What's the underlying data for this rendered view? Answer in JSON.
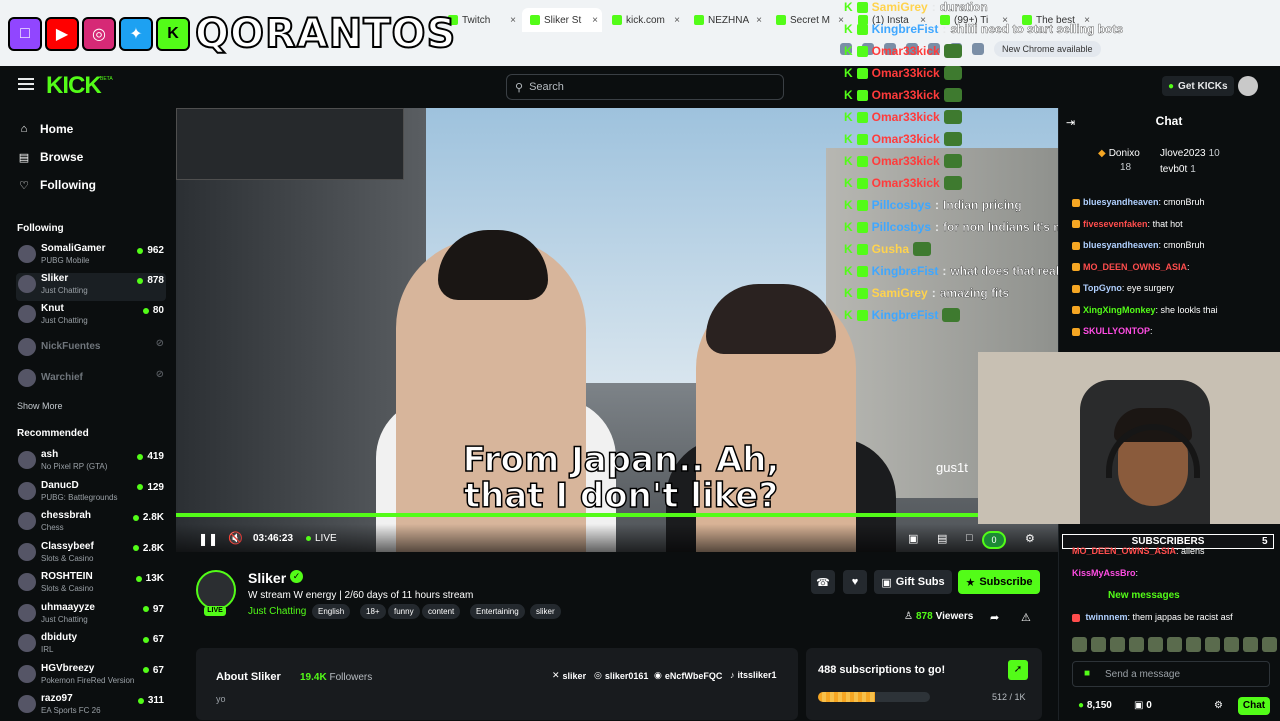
{
  "browser": {
    "tabs": [
      {
        "label": "Twitch"
      },
      {
        "label": "Sliker St"
      },
      {
        "label": "kick.com"
      },
      {
        "label": "NEZHNA"
      },
      {
        "label": "Secret M"
      },
      {
        "label": "(1) Insta"
      },
      {
        "label": "(99+) Ti"
      },
      {
        "label": "The best"
      }
    ],
    "new_chrome_label": "New Chrome available"
  },
  "overlay": {
    "brand_text": "QORANTOS",
    "chat": [
      {
        "user": "SamiGrey",
        "message": "duration",
        "user_color": "#ffd34d"
      },
      {
        "user": "KingbreFist",
        "message": "shiiii need to start selling bots",
        "user_color": "#3fa7ff"
      },
      {
        "user": "Omar33kick",
        "message": "",
        "user_color": "#ff3b3b"
      },
      {
        "user": "Omar33kick",
        "message": "",
        "user_color": "#ff3b3b"
      },
      {
        "user": "Omar33kick",
        "message": "",
        "user_color": "#ff3b3b"
      },
      {
        "user": "Omar33kick",
        "message": "",
        "user_color": "#ff3b3b"
      },
      {
        "user": "Omar33kick",
        "message": "",
        "user_color": "#ff3b3b"
      },
      {
        "user": "Omar33kick",
        "message": "",
        "user_color": "#ff3b3b"
      },
      {
        "user": "Omar33kick",
        "message": "",
        "user_color": "#ff3b3b"
      },
      {
        "user": "Pillcosbys",
        "message": "Indian pricing",
        "user_color": "#3fa7ff"
      },
      {
        "user": "Pillcosbys",
        "message": "for non Indians it's more expensive",
        "user_color": "#3fa7ff"
      },
      {
        "user": "Gusha",
        "message": "",
        "user_color": "#ffd34d"
      },
      {
        "user": "KingbreFist",
        "message": "what does that really get u in the long though",
        "user_color": "#3fa7ff"
      },
      {
        "user": "SamiGrey",
        "message": "amazing fits",
        "user_color": "#ffd34d"
      },
      {
        "user": "KingbreFist",
        "message": "",
        "user_color": "#3fa7ff"
      }
    ]
  },
  "header": {
    "logo": "KICK",
    "logo_badge": "BETA",
    "search_placeholder": "Search",
    "get_kicks_label": "Get KICKs"
  },
  "sidebar": {
    "nav": [
      {
        "label": "Home",
        "icon": "home-icon"
      },
      {
        "label": "Browse",
        "icon": "browse-icon"
      },
      {
        "label": "Following",
        "icon": "heart-icon"
      }
    ],
    "following_heading": "Following",
    "following": [
      {
        "name": "SomaliGamer",
        "category": "PUBG Mobile",
        "viewers": "962",
        "live": true
      },
      {
        "name": "Sliker",
        "category": "Just Chatting",
        "viewers": "878",
        "live": true
      },
      {
        "name": "Knut",
        "category": "Just Chatting",
        "viewers": "80",
        "live": true
      },
      {
        "name": "NickFuentes",
        "category": "",
        "viewers": "",
        "live": false
      },
      {
        "name": "Warchief",
        "category": "",
        "viewers": "",
        "live": false
      }
    ],
    "show_more": "Show More",
    "recommended_heading": "Recommended",
    "recommended": [
      {
        "name": "ash",
        "category": "No Pixel RP (GTA)",
        "viewers": "419"
      },
      {
        "name": "DanucD",
        "category": "PUBG: Battlegrounds",
        "viewers": "129"
      },
      {
        "name": "chessbrah",
        "category": "Chess",
        "viewers": "2.8K"
      },
      {
        "name": "Classybeef",
        "category": "Slots & Casino",
        "viewers": "2.8K"
      },
      {
        "name": "ROSHTEIN",
        "category": "Slots & Casino",
        "viewers": "13K"
      },
      {
        "name": "uhmaayyze",
        "category": "Just Chatting",
        "viewers": "97"
      },
      {
        "name": "dbiduty",
        "category": "IRL",
        "viewers": "67"
      },
      {
        "name": "HGVbreezy",
        "category": "Pokemon FireRed Version",
        "viewers": "67"
      },
      {
        "name": "razo97",
        "category": "EA Sports FC 26",
        "viewers": "311"
      }
    ]
  },
  "player": {
    "subtitle_line1": "From Japan.. Ah,",
    "subtitle_line2": "that I don't like?",
    "watermark": "gus1t",
    "time": "03:46:23",
    "live_label": "LIVE",
    "progress": 1.0
  },
  "channel": {
    "name": "Sliker",
    "live_badge": "LIVE",
    "title": "W stream W energy | 2/60 days of 11 hours stream",
    "category": "Just Chatting",
    "tags": [
      "English",
      "18+",
      "funny",
      "content",
      "Entertaining",
      "sliker"
    ],
    "gift_subs_label": "Gift Subs",
    "subscribe_label": "Subscribe",
    "viewers": "878",
    "viewers_label": "Viewers",
    "about_title": "About Sliker",
    "followers": "19.4K",
    "followers_label": "Followers",
    "bio": "yo",
    "socials": [
      {
        "label": "sliker",
        "icon": "x-icon"
      },
      {
        "label": "sliker0161",
        "icon": "instagram-icon"
      },
      {
        "label": "eNcfWbeFQC",
        "icon": "discord-icon"
      },
      {
        "label": "itssliker1",
        "icon": "tiktok-icon"
      }
    ],
    "sub_goal_text": "488 subscriptions to go!",
    "sub_goal_count": "512 / 1K",
    "sub_goal_progress": 0.512
  },
  "chat": {
    "title": "Chat",
    "gifters": [
      {
        "name": "Donixo",
        "count": "18"
      },
      {
        "name": "Jlove2023",
        "count": "10"
      },
      {
        "name": "tevb0t",
        "count": "1"
      }
    ],
    "messages": [
      {
        "user": "bluesyandheaven",
        "text": "cmonBruh",
        "color": "#b0d0ff"
      },
      {
        "user": "fivesevenfaken",
        "text": "that hot",
        "color": "#ff4d4d"
      },
      {
        "user": "bluesyandheaven",
        "text": "cmonBruh",
        "color": "#b0d0ff"
      },
      {
        "user": "MO_DEEN_OWNS_ASIA",
        "text": "",
        "color": "#ff4d4d"
      },
      {
        "user": "TopGyno",
        "text": "eye surgery",
        "color": "#b0d0ff"
      },
      {
        "user": "XingXingMonkey",
        "text": "she lookls thai",
        "color": "#53fc18"
      },
      {
        "user": "SKULLYONTOP",
        "text": "",
        "color": "#ff4de3"
      }
    ],
    "subscribers_label": "SUBSCRIBERS",
    "subscribers_count": "5",
    "subscribers_goal_badge": "0",
    "lower_messages": [
      {
        "user": "MO_DEEN_OWNS_ASIA",
        "text": "aliens",
        "color": "#ff4d4d"
      },
      {
        "user": "KissMyAssBro",
        "text": "",
        "color": "#ff4de3"
      }
    ],
    "new_messages_label": "New messages",
    "last_message": {
      "user": "twinnnem",
      "text": "them jappas be racist asf",
      "color": "#b0d0ff"
    },
    "input_placeholder": "Send a message",
    "kicks_balance": "8,150",
    "gift_balance": "0",
    "chat_button": "Chat"
  },
  "colors": {
    "accent": "#53fc18",
    "background": "#0b0e0f",
    "panel": "#181b1e"
  }
}
